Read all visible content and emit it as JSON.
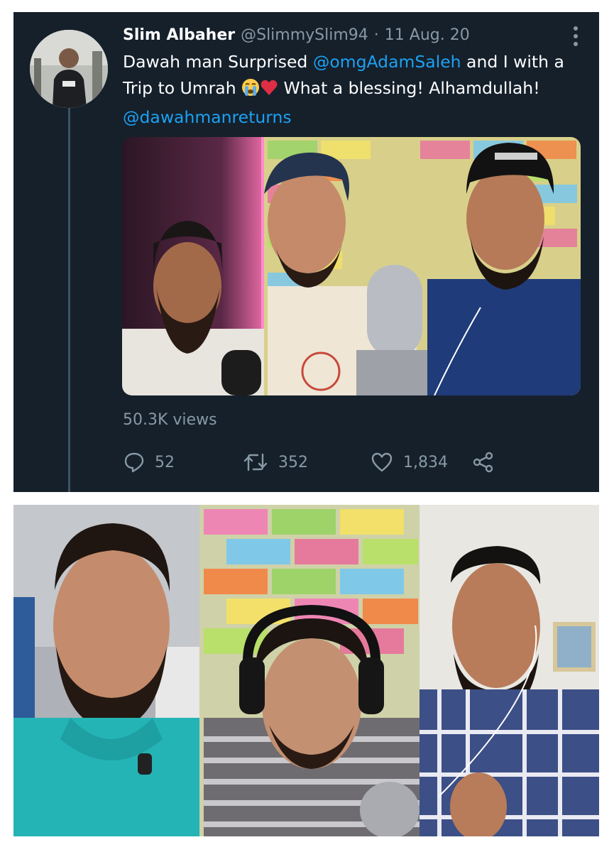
{
  "tweet": {
    "author_name": "Slim Albaher",
    "handle": "@SlimmySlim94",
    "separator": "·",
    "date": "11 Aug. 20",
    "text": {
      "part1": "Dawah man Surprised ",
      "mention1": "@omgAdamSaleh",
      "part2": " and I with a Trip to Umrah ",
      "part3": " What a blessing! Alhamdullah! ",
      "mention2": "@dawahmanreturns"
    },
    "views": "50.3K views",
    "counts": {
      "replies": "52",
      "retweets": "352",
      "likes": "1,834"
    }
  },
  "colors": {
    "background": "#15202b",
    "text": "#ffffff",
    "secondary": "#8899a6",
    "link": "#1da1f2",
    "heart": "#e0245e"
  },
  "icons": [
    "more-vertical-icon",
    "crying-face-emoji",
    "red-heart-emoji",
    "reply-icon",
    "retweet-icon",
    "like-icon",
    "share-icon"
  ]
}
